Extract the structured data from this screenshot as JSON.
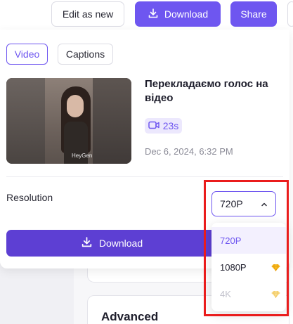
{
  "toolbar": {
    "edit_label": "Edit as new",
    "download_label": "Download",
    "share_label": "Share"
  },
  "tabs": [
    {
      "label": "Video",
      "active": true
    },
    {
      "label": "Captions",
      "active": false
    }
  ],
  "video": {
    "title": "Перекладаємо голос на відео",
    "duration": "23s",
    "date": "Dec 6, 2024, 6:32 PM",
    "watermark": "HeyGen"
  },
  "resolution": {
    "label": "Resolution",
    "selected": "720P",
    "options": [
      {
        "label": "720P",
        "premium": false,
        "disabled": false,
        "selected": true
      },
      {
        "label": "1080P",
        "premium": true,
        "disabled": false,
        "selected": false
      },
      {
        "label": "4K",
        "premium": true,
        "disabled": true,
        "selected": false
      }
    ]
  },
  "download_button_label": "Download",
  "background": {
    "advanced_label": "Advanced"
  },
  "colors": {
    "accent": "#6e56f0",
    "download_primary": "#5d3fd3",
    "highlight": "#ea1c1c",
    "premium_gem": "#f5b921"
  },
  "icons": {
    "download": "download-icon",
    "video_duration": "video-camera-icon",
    "chevron": "chevron-up-icon",
    "premium": "diamond-icon"
  }
}
